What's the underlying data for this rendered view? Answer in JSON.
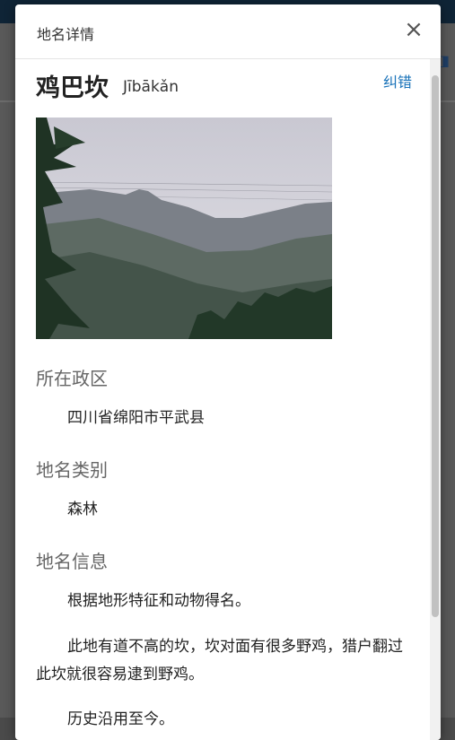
{
  "modal": {
    "title": "地名详情",
    "close_label": "×"
  },
  "place": {
    "name": "鸡巴坎",
    "pinyin": "Jībākǎn",
    "report_label": "纠错",
    "photo": {
      "description_icon": "mountain-photo"
    }
  },
  "sections": {
    "admin_region": {
      "title": "所在政区",
      "text": "四川省绵阳市平武县"
    },
    "category": {
      "title": "地名类别",
      "text": "森林"
    },
    "info": {
      "title": "地名信息",
      "paragraphs": [
        "根据地形特征和动物得名。",
        "此地有道不高的坎，坎对面有很多野鸡，猎户翻过此坎就很容易逮到野鸡。",
        "历史沿用至今。"
      ]
    }
  },
  "colors": {
    "link": "#1a73b9",
    "section_title": "#666666",
    "backdrop_topbar": "#0f2436"
  }
}
